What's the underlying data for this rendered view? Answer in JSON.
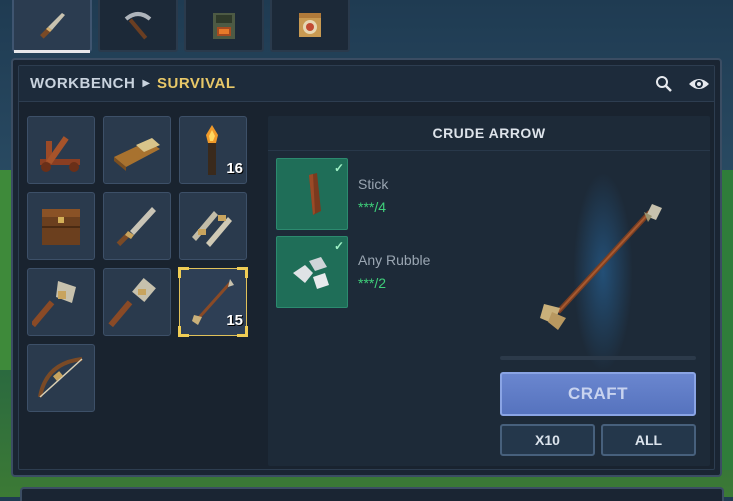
{
  "tabs": [
    {
      "name": "knife-icon",
      "active": true
    },
    {
      "name": "pickaxe-icon",
      "active": false
    },
    {
      "name": "furnace-icon",
      "active": false
    },
    {
      "name": "target-block-icon",
      "active": false
    }
  ],
  "header": {
    "crumb_1": "WORKBENCH",
    "crumb_2": "SURVIVAL",
    "icons": [
      "search-icon",
      "eye-icon"
    ]
  },
  "grid": {
    "slots": [
      {
        "icon": "catapult-icon",
        "count": ""
      },
      {
        "icon": "bedroll-icon",
        "count": ""
      },
      {
        "icon": "torch-icon",
        "count": "16"
      },
      {
        "icon": "crate-icon",
        "count": ""
      },
      {
        "icon": "stone-knife-icon",
        "count": ""
      },
      {
        "icon": "stone-daggers-icon",
        "count": ""
      },
      {
        "icon": "stone-axe-icon",
        "count": ""
      },
      {
        "icon": "stone-hammer-icon",
        "count": ""
      },
      {
        "icon": "crude-arrow-icon",
        "count": "15",
        "selected": true
      },
      {
        "icon": "crude-bow-icon",
        "count": ""
      }
    ]
  },
  "detail": {
    "title": "CRUDE ARROW",
    "ingredients": [
      {
        "icon": "stick-icon",
        "name": "Stick",
        "have": "***",
        "need": "/4"
      },
      {
        "icon": "rubble-icon",
        "name": "Any Rubble",
        "have": "***",
        "need": "/2"
      }
    ],
    "preview_icon": "crude-arrow-icon"
  },
  "actions": {
    "craft_label": "CRAFT",
    "x10_label": "X10",
    "all_label": "ALL"
  }
}
